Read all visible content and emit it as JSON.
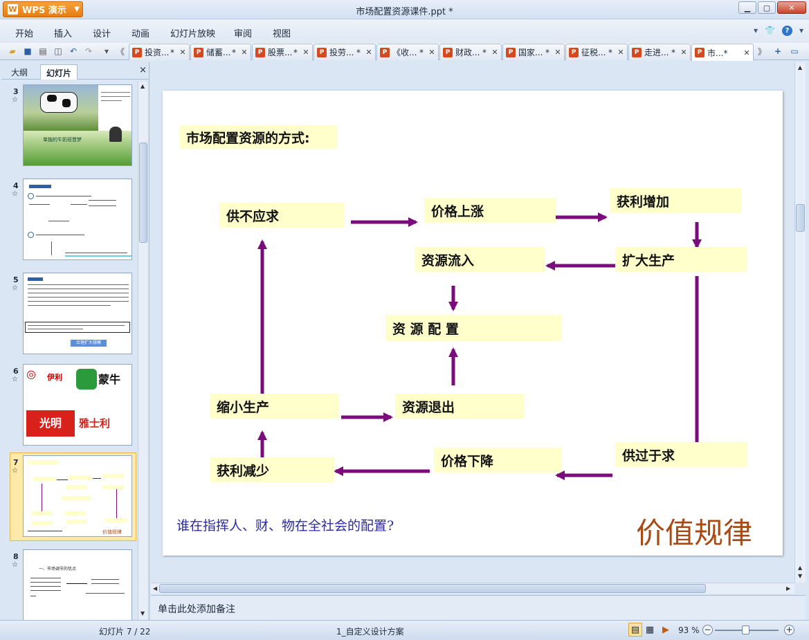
{
  "app": {
    "brand": "WPS 演示",
    "title": "市场配置资源课件.ppt *"
  },
  "menu": [
    "开始",
    "插入",
    "设计",
    "动画",
    "幻灯片放映",
    "审阅",
    "视图"
  ],
  "tabs": [
    {
      "label": "投资...",
      "mod": "*"
    },
    {
      "label": "储蓄...",
      "mod": "*"
    },
    {
      "label": "股票...",
      "mod": "*"
    },
    {
      "label": "投劳...",
      "mod": "*"
    },
    {
      "label": "《收...",
      "mod": "*"
    },
    {
      "label": "财政...",
      "mod": "*"
    },
    {
      "label": "国家...",
      "mod": "*"
    },
    {
      "label": "征税...",
      "mod": "*"
    },
    {
      "label": "走进...",
      "mod": "*"
    },
    {
      "label": "市...*",
      "mod": ""
    }
  ],
  "left_panel": {
    "tab_outline": "大纲",
    "tab_slides": "幻灯片",
    "close": "×",
    "thumbs": [
      {
        "num": "3",
        "caption": "单独的牛奶班晋梦"
      },
      {
        "num": "4"
      },
      {
        "num": "5",
        "button": "合理扩大规模"
      },
      {
        "num": "6",
        "brand1": "伊利",
        "brand2": "蒙牛",
        "brand3": "光明",
        "brand4": "雅士利"
      },
      {
        "num": "7",
        "law": "价值规律"
      },
      {
        "num": "8",
        "title": "一、市场调节的优点"
      }
    ]
  },
  "slide": {
    "title": "市场配置资源的方式:",
    "boxes": {
      "shortage": "供不应求",
      "price_up": "价格上涨",
      "profit_up": "获利增加",
      "inflow": "资源流入",
      "expand": "扩大生产",
      "allocation": "资 源 配 置",
      "shrink": "缩小生产",
      "outflow": "资源退出",
      "price_down": "价格下降",
      "surplus": "供过于求",
      "profit_down": "获利减少"
    },
    "question": "谁在指挥人、财、物在全社会的配置?",
    "law": "价值规律",
    "arrow_color": "#7b0c7b"
  },
  "notes_placeholder": "单击此处添加备注",
  "status": {
    "slide_indicator": "幻灯片 7 / 22",
    "theme": "1_自定义设计方案",
    "zoom": "93 %"
  }
}
